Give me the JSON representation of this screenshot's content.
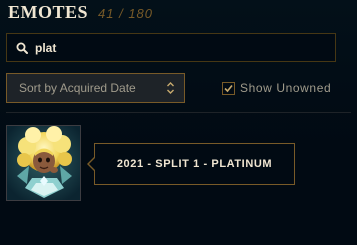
{
  "header": {
    "title": "EMOTES",
    "count": "41 / 180"
  },
  "search": {
    "value": "plat",
    "icon": "search-icon"
  },
  "sort": {
    "selected": "Sort by Acquired Date",
    "icon": "chevron-up-down-icon"
  },
  "filter": {
    "show_unowned_label": "Show Unowned",
    "show_unowned_checked": true
  },
  "emotes": [
    {
      "tooltip": "2021 - SPLIT 1 - PLATINUM"
    }
  ],
  "colors": {
    "background": "#010a13",
    "gold": "#785a28",
    "text_light": "#f0e6d2",
    "text_muted": "#a09b8c"
  }
}
